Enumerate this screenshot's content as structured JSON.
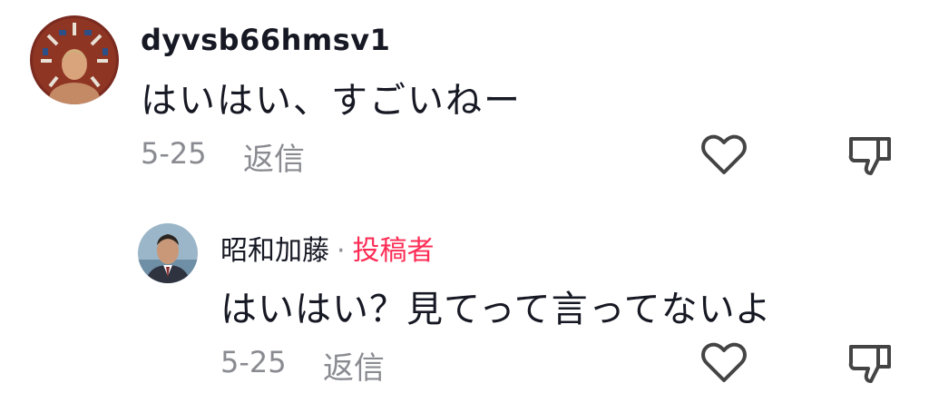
{
  "comments": [
    {
      "username": "dyvsb66hmsv1",
      "text": "はいはい、すごいねー",
      "date": "5-25",
      "reply_label": "返信",
      "avatar_icon": "user-avatar-photo",
      "like_icon": "heart-outline-icon",
      "dislike_icon": "thumbs-down-outline-icon"
    }
  ],
  "replies": [
    {
      "username": "昭和加藤",
      "separator": "·",
      "author_badge": "投稿者",
      "text": "はいはい？見てって言ってないよ",
      "date": "5-25",
      "reply_label": "返信",
      "avatar_icon": "user-avatar-photo",
      "like_icon": "heart-outline-icon",
      "dislike_icon": "thumbs-down-outline-icon"
    }
  ],
  "colors": {
    "text": "#161823",
    "meta": "#8a8b91",
    "author_badge": "#fe2c55",
    "icon_stroke": "#444444"
  }
}
